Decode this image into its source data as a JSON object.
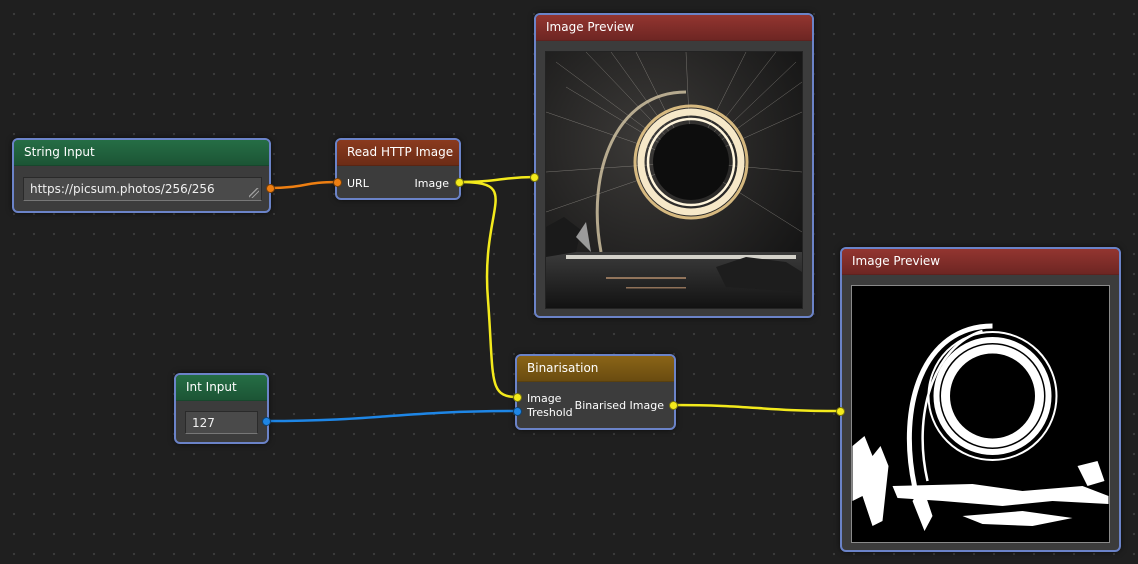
{
  "colors": {
    "background": "#1f1f1f",
    "node_border": "#6b83c8",
    "wire_image": "#f3ea1c",
    "wire_string": "#ee7f12",
    "wire_int": "#1e86e6"
  },
  "nodes": {
    "string_input": {
      "title": "String Input",
      "value": "https://picsum.photos/256/256"
    },
    "read_http_image": {
      "title": "Read HTTP Image",
      "input_label": "URL",
      "output_label": "Image"
    },
    "image_preview_top": {
      "title": "Image Preview",
      "image": "light-painting-steel-wool-ring-photo"
    },
    "binarisation": {
      "title": "Binarisation",
      "input_image_label": "Image",
      "input_threshold_label": "Treshold",
      "output_label": "Binarised Image"
    },
    "int_input": {
      "title": "Int Input",
      "value": "127"
    },
    "image_preview_right": {
      "title": "Image Preview",
      "image": "binarised-ring-photo"
    }
  }
}
